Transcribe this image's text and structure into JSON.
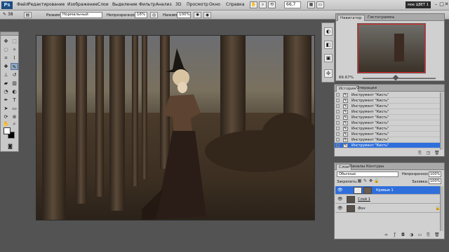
{
  "app": {
    "logo": "Ps",
    "workspace": "мое ЦВЕТ 1",
    "zoom": "66,7"
  },
  "menu": [
    "Файл",
    "Редактирование",
    "Изображение",
    "Слои",
    "Выделение",
    "Фильтр",
    "Анализ",
    "3D",
    "Просмотр",
    "Окно",
    "Справка"
  ],
  "window_controls": {
    "minimize": "–",
    "restore": "□",
    "close": "✕"
  },
  "options": {
    "brush_size": "38",
    "mode_label": "Режим:",
    "mode_value": "Нормальный",
    "opacity_label": "Непрозрачность:",
    "opacity_value": "16%",
    "flow_label": "Нажим:",
    "flow_value": "100%"
  },
  "navigator": {
    "tabs": [
      "Навигатор",
      "Гистограмма"
    ],
    "zoom": "66.67%"
  },
  "history": {
    "tabs": [
      "История",
      "Операции"
    ],
    "items": [
      "Инструмент \"Кисть\"",
      "Инструмент \"Кисть\"",
      "Инструмент \"Кисть\"",
      "Инструмент \"Кисть\"",
      "Инструмент \"Кисть\"",
      "Инструмент \"Кисть\"",
      "Инструмент \"Кисть\"",
      "Инструмент \"Кисть\"",
      "Инструмент \"Кисть\"",
      "Инструмент \"Кисть\""
    ]
  },
  "layers": {
    "tabs": [
      "Слои",
      "Каналы",
      "Контуры"
    ],
    "blend_mode": "Обычные",
    "opacity_label": "Непрозрачность:",
    "opacity_value": "100%",
    "lock_label": "Закрепить:",
    "fill_label": "Заливка:",
    "fill_value": "100%",
    "items": [
      "Кривые 1",
      "Слой 1",
      "Фон"
    ]
  },
  "colors": {
    "selection": "#2f6fdb",
    "accent": "#1e4a7f"
  }
}
